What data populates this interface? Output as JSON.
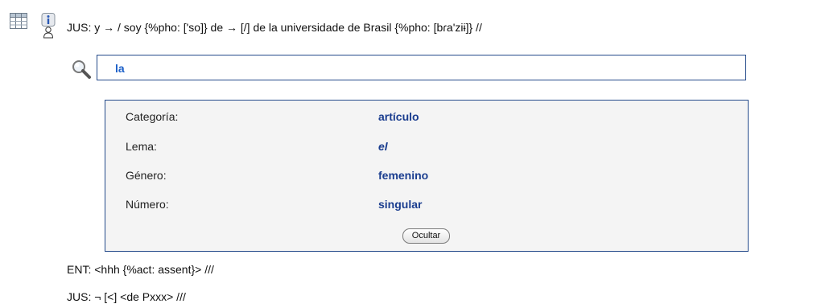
{
  "toolbar": {
    "table_icon": "table-icon",
    "info_icon": "info-user-icon"
  },
  "utterances": {
    "jus_1": "JUS: y → / soy {%pho: ['so]} de → [/] de la universidade de Brasil {%pho: [bɾa'ziɨ]} //",
    "ent": "ENT: <hhh {%act: assent}> ///",
    "jus_2": "JUS: ¬ [<] <de Pxxx> ///"
  },
  "search": {
    "icon": "magnifier-icon",
    "value": "la"
  },
  "info": {
    "fields": [
      {
        "label": "Categoría:",
        "value": "artículo"
      },
      {
        "label": "Lema:",
        "value": "el"
      },
      {
        "label": "Género:",
        "value": "femenino"
      },
      {
        "label": "Número:",
        "value": "singular"
      }
    ],
    "hide_button": "Ocultar"
  },
  "colors": {
    "border_accent": "#244a8a",
    "value_text": "#1a3d8f",
    "search_text": "#1b5fc8",
    "panel_background": "#f4f4f4"
  }
}
